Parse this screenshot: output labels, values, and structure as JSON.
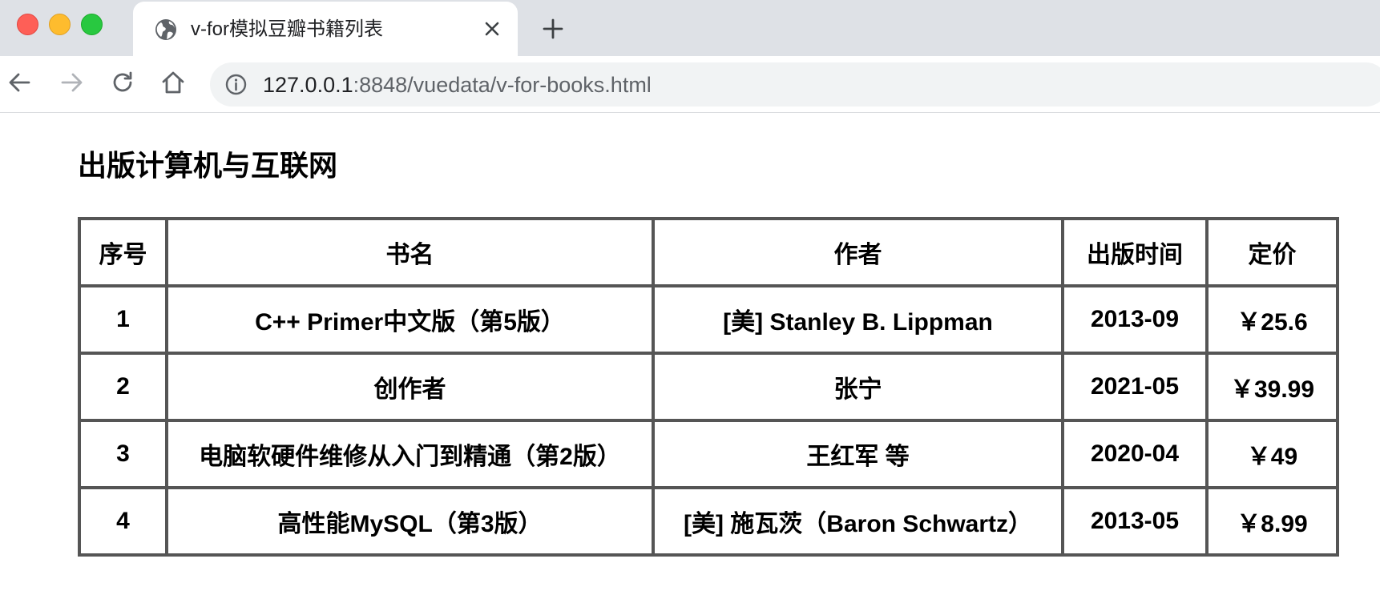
{
  "browser": {
    "tab_title": "v-for模拟豆瓣书籍列表",
    "url_host": "127.0.0.1",
    "url_rest": ":8848/vuedata/v-for-books.html"
  },
  "page": {
    "heading": "出版计算机与互联网",
    "table": {
      "headers": [
        "序号",
        "书名",
        "作者",
        "出版时间",
        "定价"
      ],
      "rows": [
        [
          "1",
          "C++ Primer中文版（第5版）",
          "[美] Stanley B. Lippman",
          "2013-09",
          "￥25.6"
        ],
        [
          "2",
          "创作者",
          "张宁",
          "2021-05",
          "￥39.99"
        ],
        [
          "3",
          "电脑软硬件维修从入门到精通（第2版）",
          "王红军 等",
          "2020-04",
          "￥49"
        ],
        [
          "4",
          "高性能MySQL（第3版）",
          "[美] 施瓦茨（Baron Schwartz）",
          "2013-05",
          "￥8.99"
        ]
      ]
    }
  },
  "icons": {
    "tab": "globe-icon",
    "tab_close": "close-icon",
    "new_tab": "plus-icon",
    "back": "arrow-left-icon",
    "forward": "arrow-right-icon",
    "reload": "reload-icon",
    "home": "home-icon",
    "site_info": "info-icon"
  },
  "colors": {
    "tab_strip": "#dee1e6",
    "omnibox": "#f1f3f4",
    "table_border": "#555555"
  }
}
